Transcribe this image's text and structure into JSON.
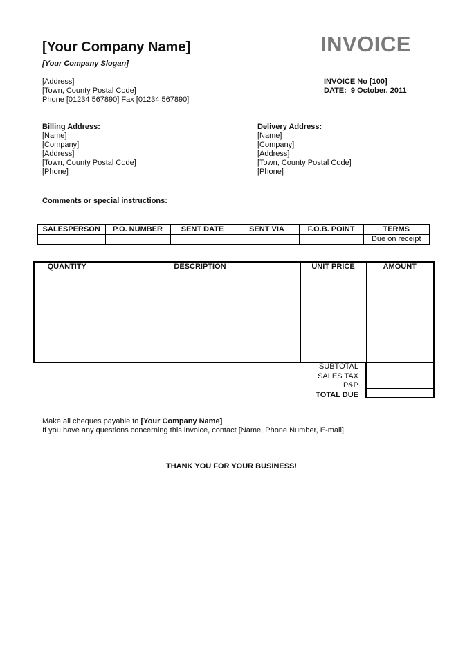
{
  "company": {
    "name": "[Your Company Name]",
    "slogan": "[Your Company Slogan]",
    "address_lines": [
      "[Address]",
      "[Town, County Postal Code]",
      "Phone [01234 567890] Fax [01234 567890]"
    ]
  },
  "invoice": {
    "title": "INVOICE",
    "number_line": "INVOICE No [100]",
    "date_line": "DATE:  9 October, 2011"
  },
  "billing": {
    "heading": "Billing Address:",
    "lines": [
      "[Name]",
      "[Company]",
      "[Address]",
      "[Town, County Postal Code]",
      "[Phone]"
    ]
  },
  "delivery": {
    "heading": "Delivery Address:",
    "lines": [
      "[Name]",
      "[Company]",
      "[Address]",
      "[Town, County Postal Code]",
      "[Phone]"
    ]
  },
  "comments_label": "Comments or special instructions:",
  "order_table": {
    "headers": [
      "SALESPERSON",
      "P.O. NUMBER",
      "SENT DATE",
      "SENT VIA",
      "F.O.B. POINT",
      "TERMS"
    ],
    "values": [
      "",
      "",
      "",
      "",
      "",
      "Due on receipt"
    ]
  },
  "items_table": {
    "headers": [
      "QUANTITY",
      "DESCRIPTION",
      "UNIT PRICE",
      "AMOUNT"
    ]
  },
  "totals": {
    "subtotal": "SUBTOTAL",
    "sales_tax": "SALES TAX",
    "pp": "P&P",
    "total_due": "TOTAL DUE"
  },
  "footer": {
    "cheques_prefix": "Make all cheques payable to ",
    "cheques_name": "[Your Company Name]",
    "questions": "If you have any questions concerning this invoice, contact [Name, Phone Number, E-mail]",
    "thanks": "THANK YOU FOR YOUR BUSINESS!"
  }
}
